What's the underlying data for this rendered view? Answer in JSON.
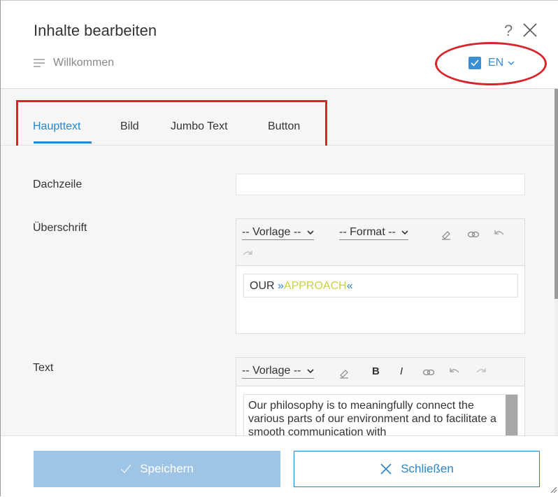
{
  "dialog": {
    "title": "Inhalte bearbeiten",
    "help": "?",
    "subtitle": "Willkommen",
    "language": "EN"
  },
  "icons": {
    "close": "close-icon",
    "help": "help-icon",
    "list": "lines-icon",
    "checkbox": "checkbox-checked-icon",
    "dropdown": "chevron-down-icon"
  },
  "tabs": [
    {
      "label": "Haupttext",
      "active": true
    },
    {
      "label": "Bild",
      "active": false
    },
    {
      "label": "Jumbo Text",
      "active": false
    },
    {
      "label": "Button",
      "active": false
    }
  ],
  "fields": {
    "dachzeile": {
      "label": "Dachzeile",
      "value": ""
    },
    "ueberschrift": {
      "label": "Überschrift",
      "template_select": "-- Vorlage --",
      "format_select": "-- Format --",
      "value_prefix": "OUR ",
      "value_open": "»",
      "value_accent": "APPROACH",
      "value_close": "«"
    },
    "text": {
      "label": "Text",
      "template_select": "-- Vorlage --",
      "bold": "B",
      "italic": "I",
      "value": "Our philosophy is to meaningfully connect the various parts of our environment and to facilitate a smooth communication with"
    }
  },
  "footer": {
    "save_label": "Speichern",
    "close_label": "Schließen"
  },
  "colors": {
    "accent": "#2b85c9",
    "save_disabled": "#9fc5e6",
    "highlight": "#c8d43a",
    "annotation_red": "#d6252b"
  }
}
